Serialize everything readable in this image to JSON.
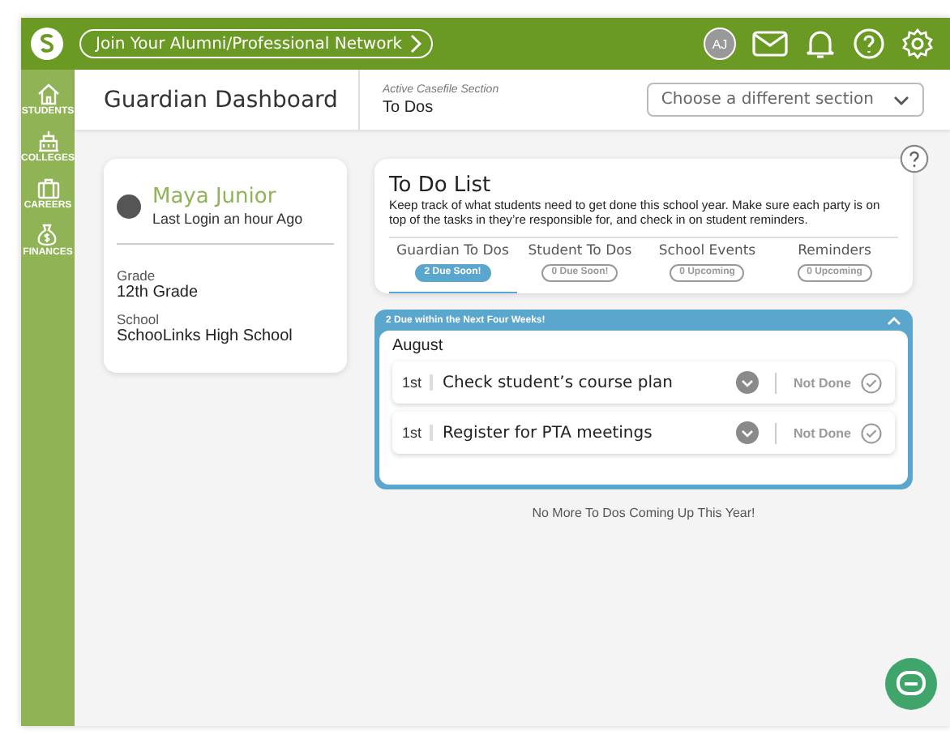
{
  "top_bar": {
    "network_link": "Join Your Alumni/Professional Network",
    "avatar_initials": "AJ"
  },
  "sidebar": {
    "items": [
      {
        "label": "STUDENTS"
      },
      {
        "label": "COLLEGES"
      },
      {
        "label": "CAREERS"
      },
      {
        "label": "FINANCES"
      }
    ]
  },
  "header": {
    "title": "Guardian Dashboard",
    "section_caption": "Active Casefile Section",
    "section": "To Dos",
    "section_select": {
      "placeholder": "Choose a different section"
    }
  },
  "student": {
    "name": "Maya Junior",
    "last_login": "Last Login an hour Ago",
    "fields": [
      {
        "label": "Grade",
        "value": "12th Grade"
      },
      {
        "label": "School",
        "value": "SchooLinks High School"
      }
    ]
  },
  "todo": {
    "title": "To Do List",
    "description": "Keep track of what students need to get done this school year. Make sure each party is on top of the tasks in they’re responsible for, and check in on student reminders.",
    "tabs": [
      {
        "label": "Guardian To Dos",
        "badge": "2 Due Soon!",
        "selected": true
      },
      {
        "label": "Student To Dos",
        "badge": "0 Due Soon!",
        "selected": false
      },
      {
        "label": "School Events",
        "badge": "0 Upcoming",
        "selected": false
      },
      {
        "label": "Reminders",
        "badge": "0 Upcoming",
        "selected": false
      }
    ],
    "group": {
      "title": "2 Due within the Next Four Weeks!",
      "expanded": true,
      "month": "August",
      "items": [
        {
          "day": "1st",
          "task": "Check student’s course plan",
          "status": "Not Done"
        },
        {
          "day": "1st",
          "task": "Register for PTA meetings",
          "status": "Not Done"
        }
      ]
    },
    "footer": "No More To Dos Coming Up This Year!"
  }
}
